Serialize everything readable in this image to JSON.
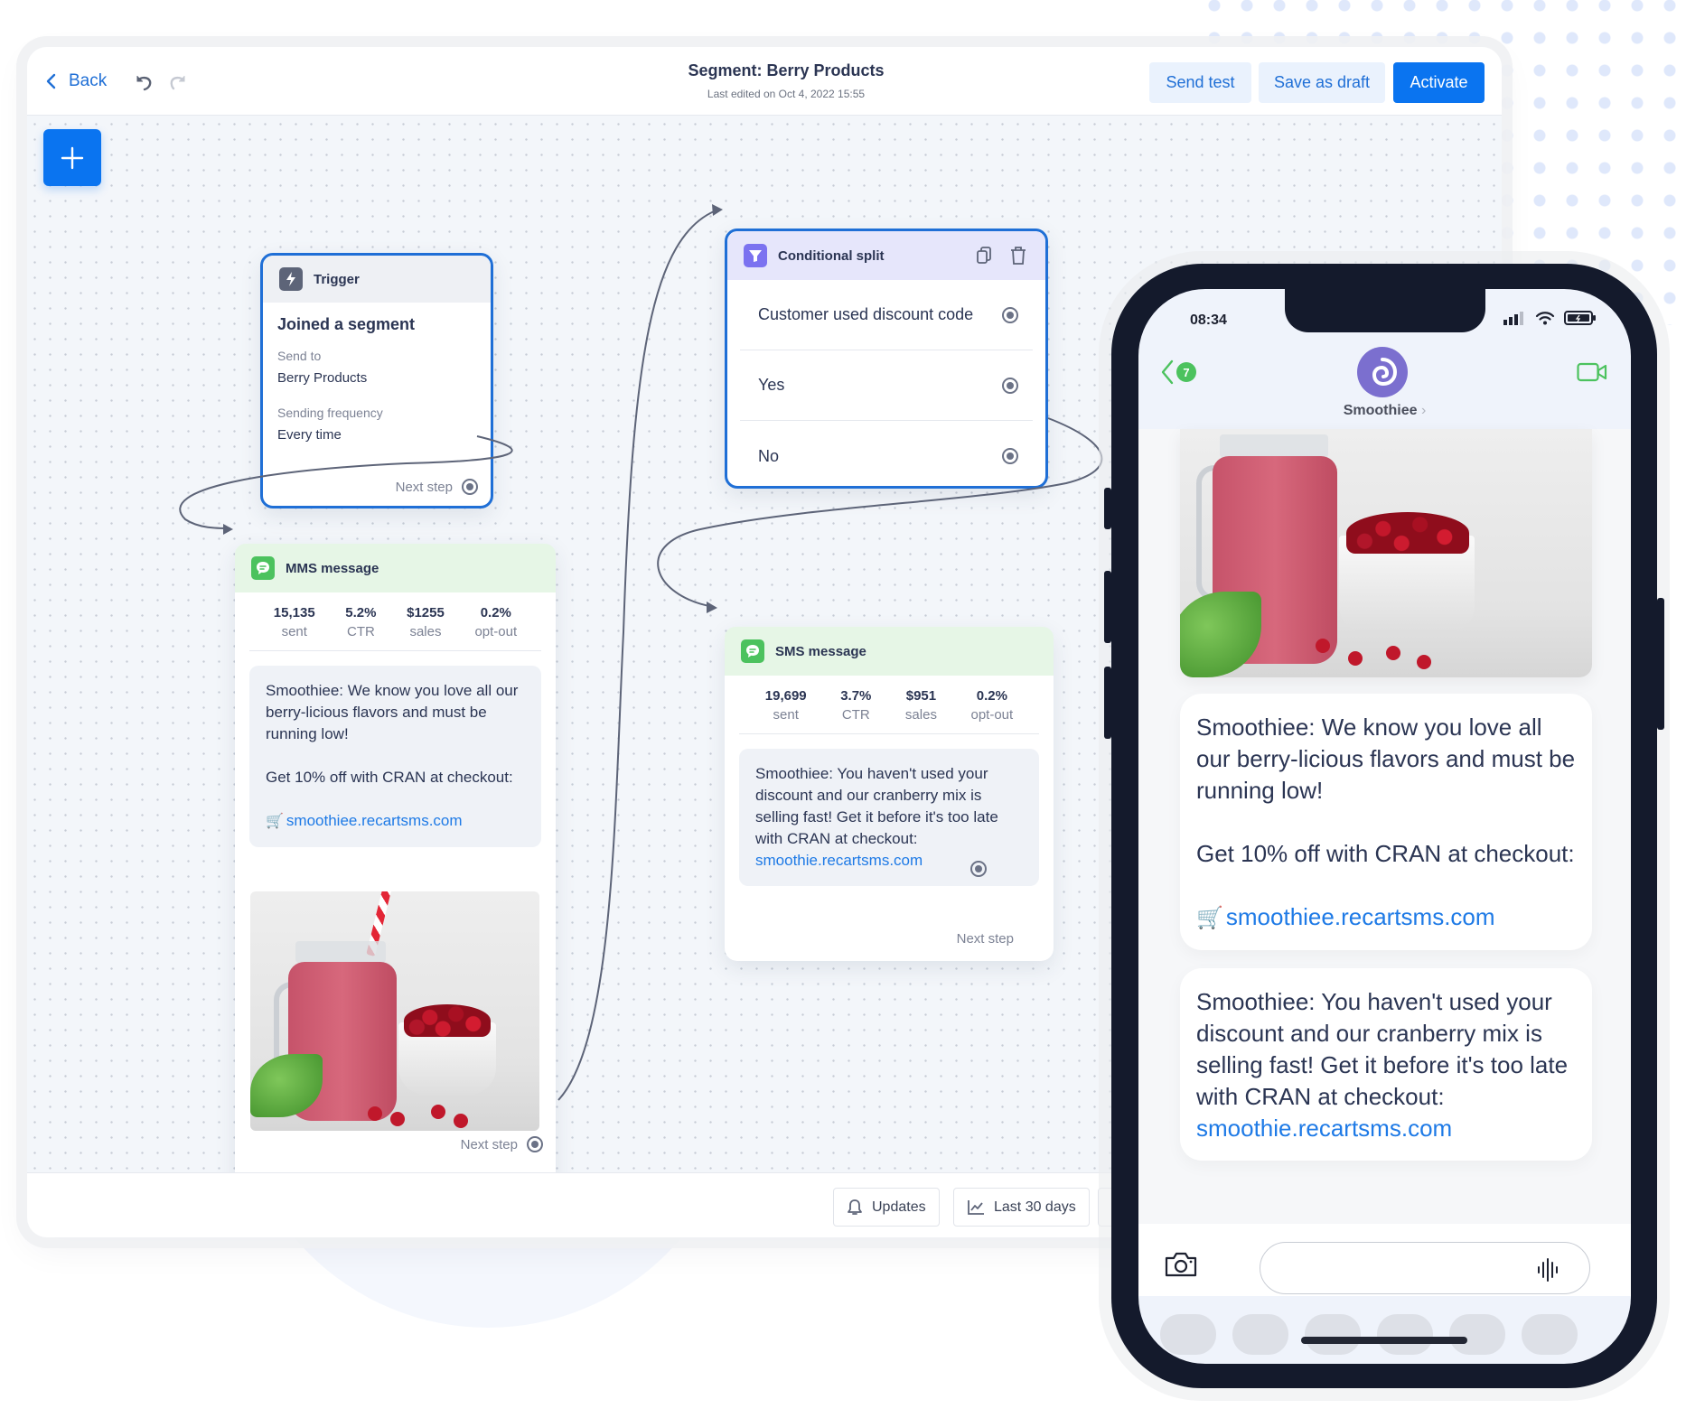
{
  "header": {
    "back_label": "Back",
    "title": "Segment: Berry Products",
    "subtitle": "Last edited on Oct 4, 2022 15:55",
    "buttons": {
      "send_test": "Send test",
      "save_draft": "Save as draft",
      "activate": "Activate"
    }
  },
  "colors": {
    "primary": "#0a74f0",
    "link": "#1e7ae6",
    "trigger_header": "#eef0f4",
    "message_header": "#e6f6e6",
    "split_header": "#e6e6fb",
    "message_icon": "#4cc25e",
    "split_icon": "#7b72f0",
    "phone_frame": "#141a2c"
  },
  "trigger_node": {
    "header": "Trigger",
    "icon": "lightning-icon",
    "title": "Joined a segment",
    "send_to_label": "Send to",
    "send_to_value": "Berry Products",
    "frequency_label": "Sending frequency",
    "frequency_value": "Every time",
    "next_step": "Next step"
  },
  "mms_node": {
    "header": "MMS message",
    "icon": "chat-bubble-icon",
    "stats": [
      {
        "value": "15,135",
        "label": "sent"
      },
      {
        "value": "5.2%",
        "label": "CTR"
      },
      {
        "value": "$1255",
        "label": "sales"
      },
      {
        "value": "0.2%",
        "label": "opt-out"
      }
    ],
    "message_line1": "Smoothiee: We know you love all our berry-licious flavors and must be running low!",
    "message_line2": "Get 10% off with CRAN at checkout:",
    "cart_emoji": "🛒",
    "link": "smoothiee.recartsms.com",
    "image_alt": "Cranberry smoothie in a jar with a bowl of cranberries",
    "next_step": "Next step"
  },
  "split_node": {
    "header": "Conditional split",
    "icon": "filter-icon",
    "rows": [
      {
        "label": "Customer used discount code"
      },
      {
        "label": "Yes"
      },
      {
        "label": "No"
      }
    ]
  },
  "sms_node": {
    "header": "SMS message",
    "icon": "chat-bubble-icon",
    "stats": [
      {
        "value": "19,699",
        "label": "sent"
      },
      {
        "value": "3.7%",
        "label": "CTR"
      },
      {
        "value": "$951",
        "label": "sales"
      },
      {
        "value": "0.2%",
        "label": "opt-out"
      }
    ],
    "message": "Smoothiee: You haven't used your discount and our cranberry mix is selling fast! Get it before it's too late with CRAN at checkout:",
    "link": "smoothie.recartsms.com",
    "next_step": "Next step"
  },
  "bottom_bar": {
    "updates": "Updates",
    "date_range": "Last 30 days"
  },
  "phone": {
    "time": "08:34",
    "back_badge": "7",
    "contact_name": "Smoothiee",
    "contact_chevron": "›",
    "messages": [
      {
        "line1": "Smoothiee: We know you love all our berry-licious flavors and must be running low!",
        "line2": "Get 10% off with CRAN at checkout:",
        "cart_emoji": "🛒",
        "link": "smoothiee.recartsms.com"
      },
      {
        "line1": "Smoothiee: You haven't used your discount and our cranberry mix is selling fast! Get it before it's too late with CRAN at checkout:",
        "link": "smoothie.recartsms.com"
      }
    ],
    "compose_placeholder": ""
  }
}
